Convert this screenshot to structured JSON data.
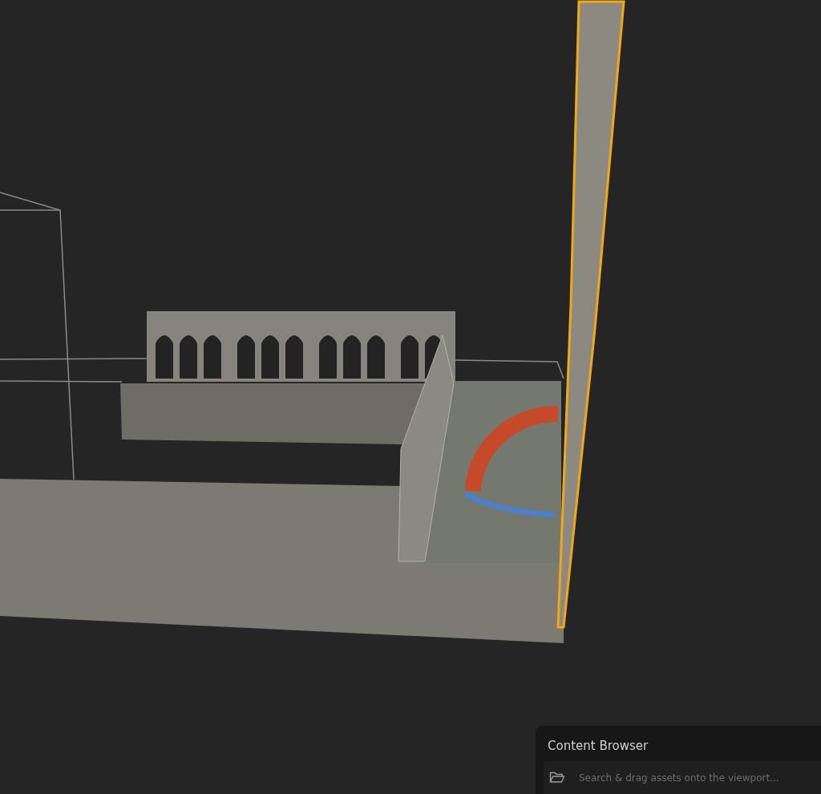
{
  "content_browser": {
    "title": "Content Browser",
    "search": {
      "placeholder": "Search & drag assets onto the viewport..."
    }
  }
}
